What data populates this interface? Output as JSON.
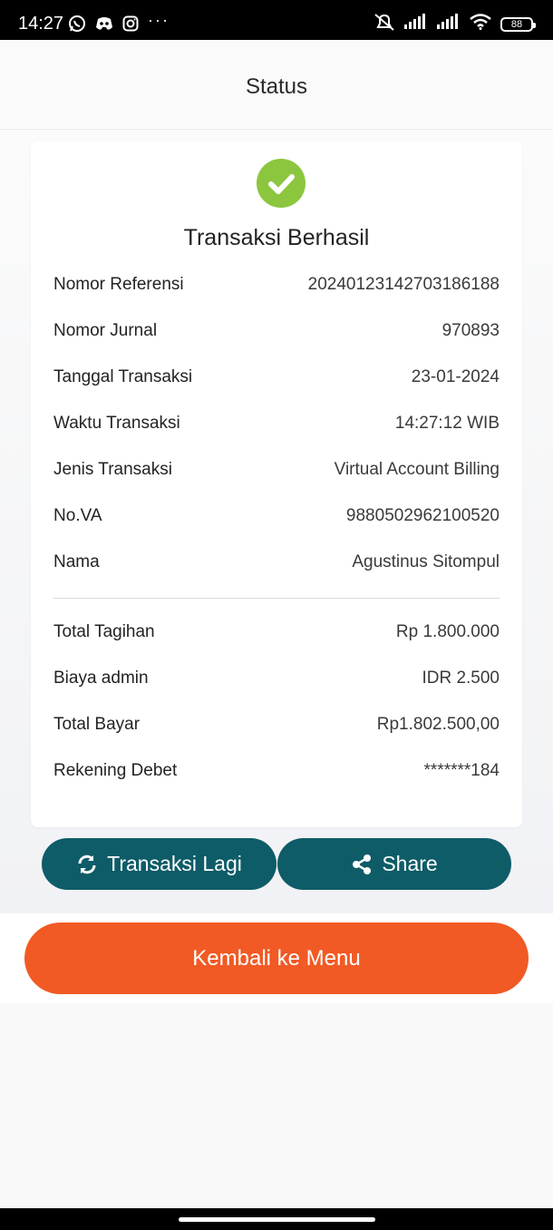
{
  "status_bar": {
    "time": "14:27",
    "battery": "88"
  },
  "header": {
    "title": "Status"
  },
  "receipt": {
    "title": "Transaksi Berhasil",
    "rows": [
      {
        "label": "Nomor Referensi",
        "value": "20240123142703186188"
      },
      {
        "label": "Nomor Jurnal",
        "value": "970893"
      },
      {
        "label": "Tanggal Transaksi",
        "value": "23-01-2024"
      },
      {
        "label": "Waktu Transaksi",
        "value": "14:27:12 WIB"
      },
      {
        "label": "Jenis Transaksi",
        "value": "Virtual Account Billing"
      },
      {
        "label": "No.VA",
        "value": "9880502962100520"
      },
      {
        "label": "Nama",
        "value": "Agustinus Sitompul"
      }
    ],
    "totals": [
      {
        "label": "Total Tagihan",
        "value": "Rp 1.800.000"
      },
      {
        "label": "Biaya admin",
        "value": "IDR 2.500"
      },
      {
        "label": "Total Bayar",
        "value": "Rp1.802.500,00"
      },
      {
        "label": "Rekening Debet",
        "value": "*******184"
      }
    ]
  },
  "actions": {
    "again_label": "Transaksi Lagi",
    "share_label": "Share",
    "menu_label": "Kembali ke Menu"
  },
  "colors": {
    "success": "#8cc63f",
    "teal": "#0e5c68",
    "orange": "#f15a24"
  },
  "icons": [
    "whatsapp-icon",
    "discord-icon",
    "instagram-icon",
    "mute-icon",
    "signal-icon",
    "wifi-icon",
    "battery-icon",
    "check-icon",
    "refresh-icon",
    "share-icon"
  ]
}
